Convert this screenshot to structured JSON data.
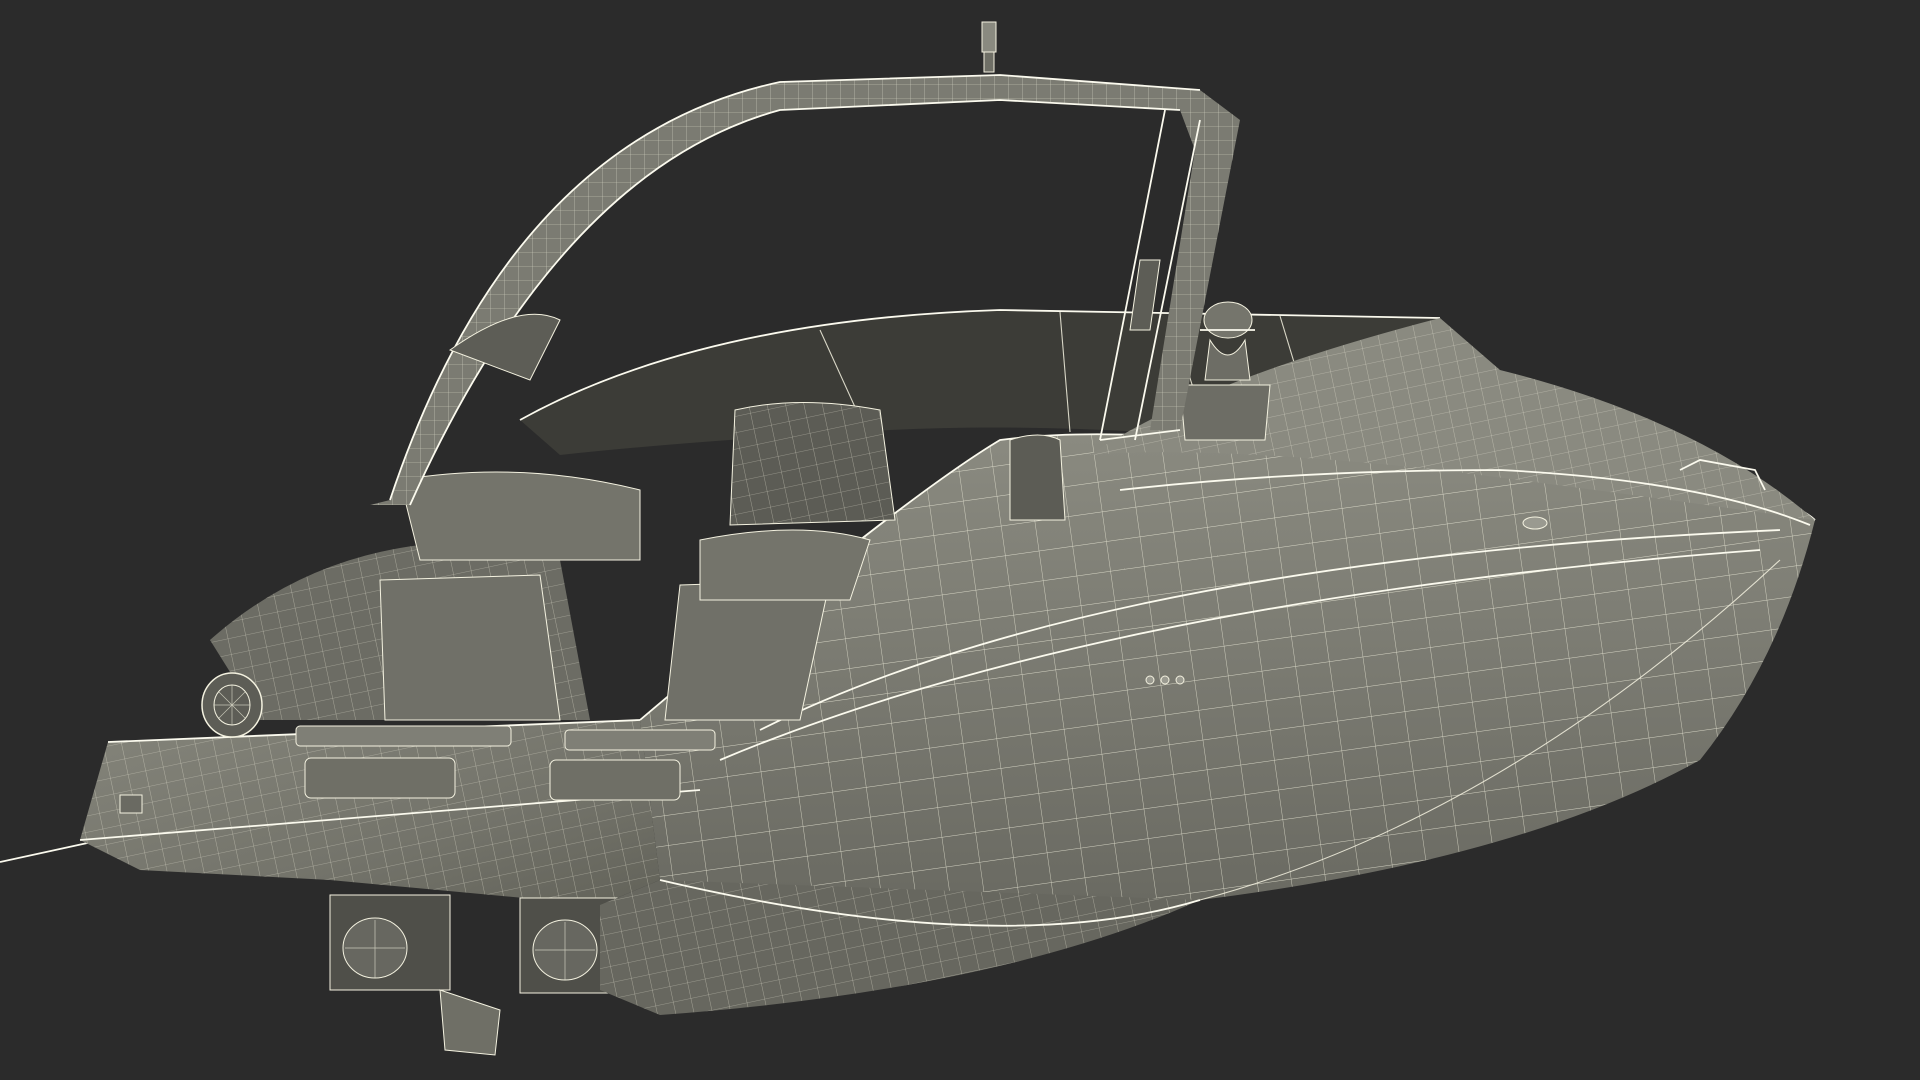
{
  "scene": {
    "background_color": "#2b2b2b",
    "surface_color": "#7a7a70",
    "surface_shadow_color": "#5f5f57",
    "wire_color": "#f4f2e0",
    "glass_color": "#3c3c37"
  }
}
